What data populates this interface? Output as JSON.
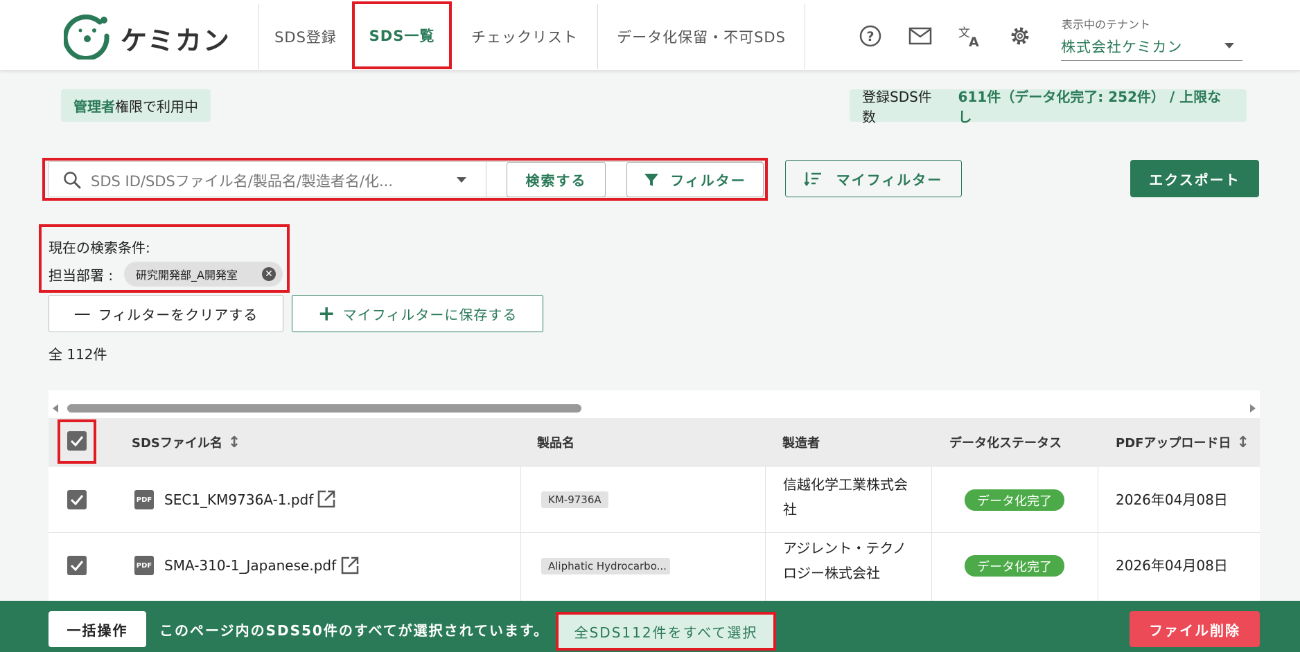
{
  "header": {
    "logo_text": "ケミカン",
    "tabs": [
      {
        "label": "SDS登録"
      },
      {
        "label": "SDS一覧"
      },
      {
        "label": "チェックリスト"
      },
      {
        "label": "データ化保留・不可SDS"
      }
    ],
    "tenant_label": "表示中のテナント",
    "tenant_value": "株式会社ケミカン"
  },
  "status": {
    "admin_strong": "管理者",
    "admin_rest": "権限で利用中",
    "count_label": "登録SDS件数",
    "count_value": "611件（データ化完了: 252件） / 上限なし"
  },
  "toolbar": {
    "search_placeholder": "SDS ID/SDSファイル名/製品名/製造者名/化...",
    "search_button": "検索する",
    "filter_button": "フィルター",
    "my_filter_button": "マイフィルター",
    "export_button": "エクスポート"
  },
  "conditions": {
    "title": "現在の検索条件:",
    "dept_label": "担当部署 :",
    "dept_chip": "研究開発部_A開発室",
    "clear_button": "フィルターをクリアする",
    "save_button": "マイフィルターに保存する",
    "total": "全 112件"
  },
  "table": {
    "columns": [
      "SDSファイル名",
      "製品名",
      "製造者",
      "データ化ステータス",
      "PDFアップロード日"
    ],
    "pdf_icon_text": "PDF",
    "rows": [
      {
        "file": "SEC1_KM9736A-1.pdf",
        "product": "KM-9736A",
        "maker_line1": "信越化学工業株式会",
        "maker_line2": "社",
        "status": "データ化完了",
        "date": "2026年04月08日"
      },
      {
        "file": "SMA-310-1_Japanese.pdf",
        "product": "Aliphatic Hydrocarbo...",
        "maker_line1": "アジレント・テクノ",
        "maker_line2": "ロジー株式会社",
        "status": "データ化完了",
        "date": "2026年04月08日"
      }
    ]
  },
  "bottom_bar": {
    "bulk_button": "一括操作",
    "message": "このページ内のSDS50件のすべてが選択されています。",
    "select_all_button": "全SDS112件をすべて選択",
    "delete_button": "ファイル削除"
  },
  "colors": {
    "brand_green": "#2a7a58",
    "badge_bg": "#dcefe6",
    "status_green": "#4caa48",
    "danger_red": "#eb4a56",
    "highlight_red": "#e01b24"
  }
}
